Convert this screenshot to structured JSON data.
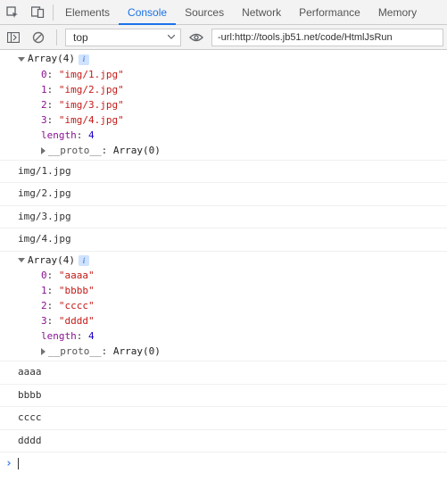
{
  "tabs": {
    "elements": "Elements",
    "console": "Console",
    "sources": "Sources",
    "network": "Network",
    "performance": "Performance",
    "memory": "Memory"
  },
  "toolbar": {
    "context": "top",
    "filter_value": "-url:http://tools.jb51.net/code/HtmlJsRun"
  },
  "array1": {
    "header": "Array(4)",
    "items": [
      {
        "idx": "0",
        "val": "\"img/1.jpg\""
      },
      {
        "idx": "1",
        "val": "\"img/2.jpg\""
      },
      {
        "idx": "2",
        "val": "\"img/3.jpg\""
      },
      {
        "idx": "3",
        "val": "\"img/4.jpg\""
      }
    ],
    "length_key": "length",
    "length_val": "4",
    "proto_key": "__proto__",
    "proto_val": "Array(0)"
  },
  "plain1": [
    "img/1.jpg",
    "img/2.jpg",
    "img/3.jpg",
    "img/4.jpg"
  ],
  "array2": {
    "header": "Array(4)",
    "items": [
      {
        "idx": "0",
        "val": "\"aaaa\""
      },
      {
        "idx": "1",
        "val": "\"bbbb\""
      },
      {
        "idx": "2",
        "val": "\"cccc\""
      },
      {
        "idx": "3",
        "val": "\"dddd\""
      }
    ],
    "length_key": "length",
    "length_val": "4",
    "proto_key": "__proto__",
    "proto_val": "Array(0)"
  },
  "plain2": [
    "aaaa",
    "bbbb",
    "cccc",
    "dddd"
  ]
}
